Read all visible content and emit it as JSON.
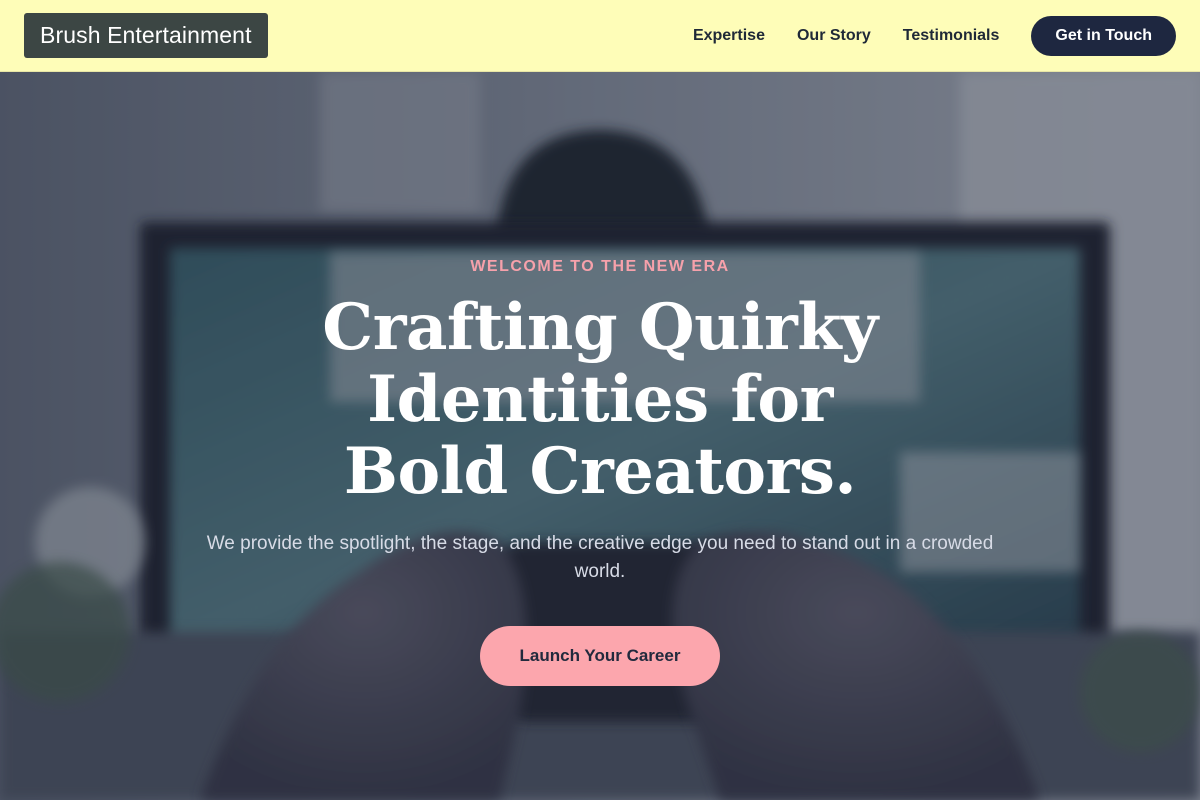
{
  "header": {
    "brand": "Brush Entertainment",
    "nav": [
      {
        "label": "Expertise"
      },
      {
        "label": "Our Story"
      },
      {
        "label": "Testimonials"
      }
    ],
    "cta_label": "Get in Touch"
  },
  "hero": {
    "eyebrow": "WELCOME TO THE NEW ERA",
    "title": "Crafting Quirky Identities for Bold Creators.",
    "subtitle": "We provide the spotlight, the stage, and the creative edge you need to stand out in a crowded world.",
    "cta_label": "Launch Your Career"
  },
  "colors": {
    "header_bg": "#fefdb8",
    "brand_bg": "#3c4644",
    "accent_pink": "#fca6ad",
    "dark_navy": "#1e2740"
  }
}
